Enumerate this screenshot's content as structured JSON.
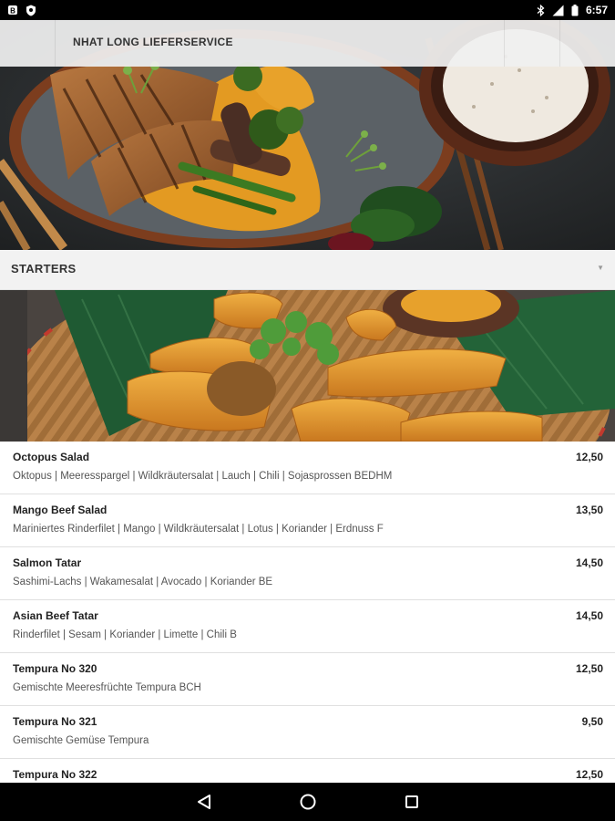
{
  "status_bar": {
    "time": "6:57",
    "left_icons": [
      "notification-b-icon",
      "shield-icon"
    ],
    "right_icons": [
      "bluetooth-icon",
      "signal-icon",
      "battery-icon"
    ]
  },
  "app_bar": {
    "title": "NHAT LONG LIEFERSERVICE"
  },
  "category": {
    "label": "STARTERS",
    "expand_icon": "chevron-down-icon"
  },
  "items": [
    {
      "name": "Octopus Salad",
      "description": "Oktopus | Meeresspargel | Wildkräutersalat | Lauch | Chili | Sojasprossen BEDHM",
      "price": "12,50"
    },
    {
      "name": "Mango Beef Salad",
      "description": "Mariniertes Rinderfilet | Mango | Wildkräutersalat | Lotus | Koriander | Erdnuss F",
      "price": "13,50"
    },
    {
      "name": "Salmon Tatar",
      "description": "Sashimi-Lachs | Wakamesalat | Avocado | Koriander BE",
      "price": "14,50"
    },
    {
      "name": "Asian Beef Tatar",
      "description": "Rinderfilet | Sesam | Koriander | Limette | Chili B",
      "price": "14,50"
    },
    {
      "name": "Tempura No 320",
      "description": "Gemischte Meeresfrüchte Tempura BCH",
      "price": "12,50"
    },
    {
      "name": "Tempura No 321",
      "description": "Gemischte Gemüse Tempura",
      "price": "9,50"
    },
    {
      "name": "Tempura No 322",
      "description": "",
      "price": "12,50"
    }
  ],
  "nav_bar": {
    "buttons": [
      "back-icon",
      "home-icon",
      "recents-icon"
    ]
  }
}
